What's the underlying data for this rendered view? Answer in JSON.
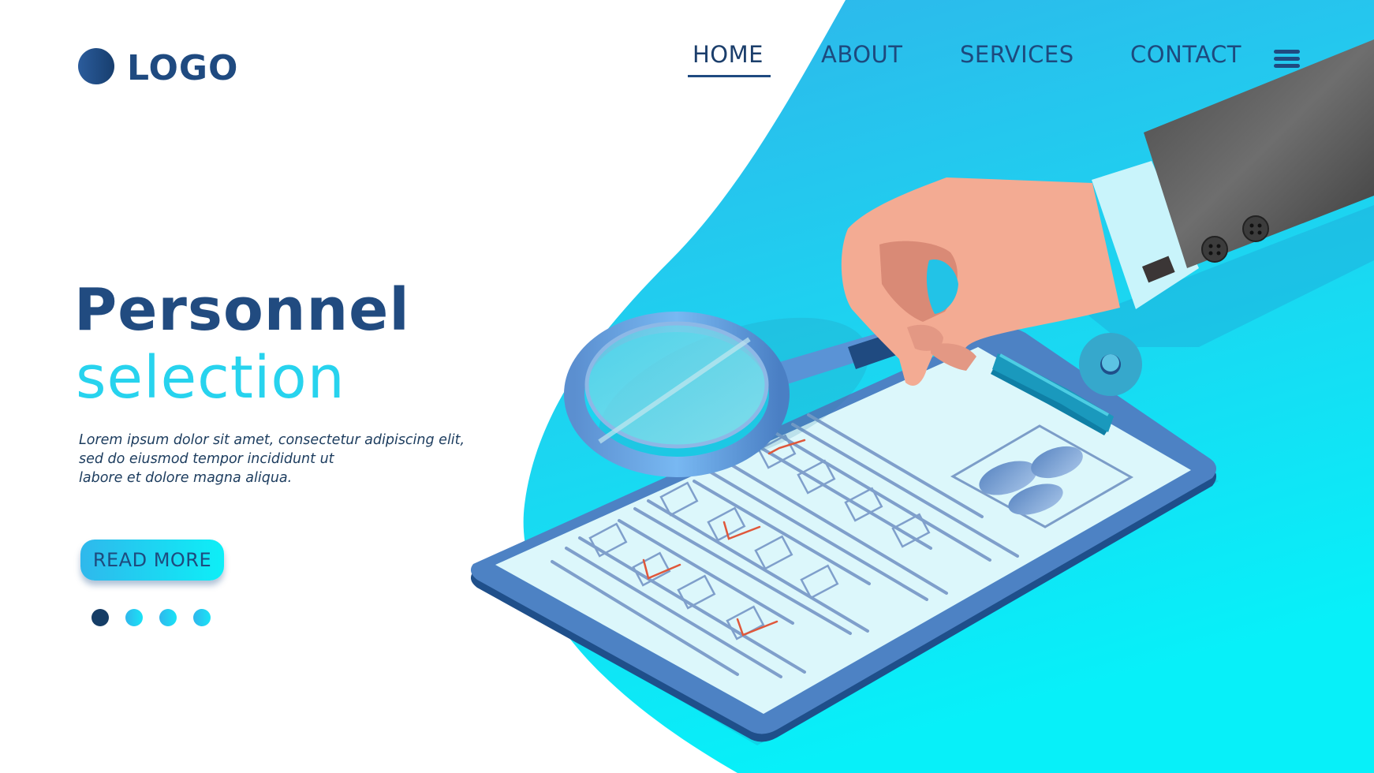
{
  "brand": {
    "logo_text": "LOGO",
    "logo_icon": "circle-logo-icon"
  },
  "nav": {
    "items": [
      {
        "label": "HOME",
        "active": true
      },
      {
        "label": "ABOUT",
        "active": false
      },
      {
        "label": "SERVICES",
        "active": false
      },
      {
        "label": "CONTACT",
        "active": false
      }
    ],
    "menu_icon": "hamburger-menu-icon"
  },
  "hero": {
    "title_line1": "Personnel",
    "title_line2": "selection",
    "description_lines": [
      "Lorem ipsum dolor sit amet, consectetur adipiscing elit,",
      "sed do eiusmod tempor incididunt ut",
      "labore et dolore magna aliqua."
    ],
    "cta_label": "READ MORE"
  },
  "slider": {
    "total": 4,
    "active_index": 0
  },
  "illustration": {
    "description": "Hand in suit sleeve holding magnifying glass over clipboard checklist",
    "checklist_checked": [
      false,
      true,
      false,
      false,
      true,
      false,
      false,
      true,
      false,
      false,
      false,
      false,
      true
    ],
    "colors": {
      "accent_dark": "#1f4a80",
      "accent_cyan": "#27d3ee",
      "check_mark": "#e0573a",
      "blob_top": "#2fb6ea",
      "blob_bottom": "#0aeef8"
    }
  }
}
